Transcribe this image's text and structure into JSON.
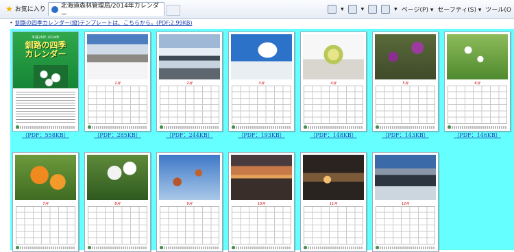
{
  "browser": {
    "favorites_label": "お気に入り",
    "tab_title": "北海道森林管理局/2014年カレンダー",
    "menu_page": "ページ(P) ▾",
    "menu_safety": "セーフティ(S) ▾",
    "menu_tools": "ツール(O"
  },
  "page": {
    "note": "釧路の四季カレンダー(縦)テンプレートは、こちらから。(PDF:2.99KB)"
  },
  "cover": {
    "subtitle": "平成26年 2014年",
    "title_line1": "釧路の四季",
    "title_line2": "カレンダー",
    "pdf": "（PDF：558KB）"
  },
  "months": [
    {
      "label": "1月",
      "pdf": "（PDF：285KB）"
    },
    {
      "label": "2月",
      "pdf": "（PDF：244KB）"
    },
    {
      "label": "3月",
      "pdf": "（PDF：193KB）"
    },
    {
      "label": "4月",
      "pdf": "（PDF：148KB）"
    },
    {
      "label": "5月",
      "pdf": "（PDF：143KB）"
    },
    {
      "label": "6月",
      "pdf": "（PDF：146KB）"
    },
    {
      "label": "7月",
      "pdf": ""
    },
    {
      "label": "8月",
      "pdf": ""
    },
    {
      "label": "9月",
      "pdf": ""
    },
    {
      "label": "10月",
      "pdf": ""
    },
    {
      "label": "11月",
      "pdf": ""
    },
    {
      "label": "12月",
      "pdf": ""
    }
  ],
  "colors": {
    "grid_background": "#66ffff",
    "link": "#1a3fb0",
    "cover_green": "#168536"
  }
}
